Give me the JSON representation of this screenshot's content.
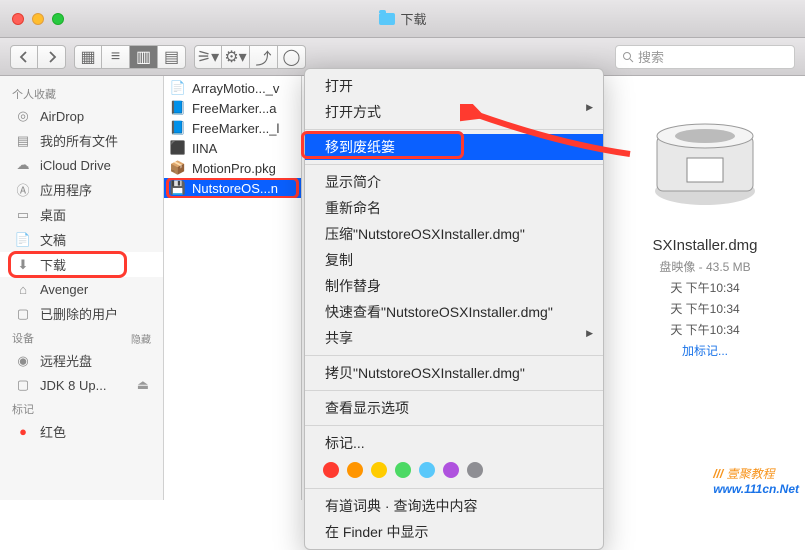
{
  "window": {
    "title": "下载"
  },
  "search": {
    "placeholder": "搜索"
  },
  "sidebar": {
    "favorites_hdr": "个人收藏",
    "items": [
      {
        "label": "AirDrop"
      },
      {
        "label": "我的所有文件"
      },
      {
        "label": "iCloud Drive"
      },
      {
        "label": "应用程序"
      },
      {
        "label": "桌面"
      },
      {
        "label": "文稿"
      },
      {
        "label": "下载"
      },
      {
        "label": "Avenger"
      },
      {
        "label": "已删除的用户"
      }
    ],
    "devices_hdr": "设备",
    "devices": [
      {
        "label": "远程光盘"
      },
      {
        "label": "JDK 8 Up..."
      }
    ],
    "tags_hdr": "标记",
    "tags": [
      {
        "label": "红色"
      }
    ]
  },
  "files": [
    {
      "name": "ArrayMotio..._v"
    },
    {
      "name": "FreeMarker...a"
    },
    {
      "name": "FreeMarker..._l"
    },
    {
      "name": "IINA"
    },
    {
      "name": "MotionPro.pkg"
    },
    {
      "name": "NutstoreOS...n"
    }
  ],
  "ctx": {
    "open": "打开",
    "openwith": "打开方式",
    "trash": "移到废纸篓",
    "getinfo": "显示简介",
    "rename": "重新命名",
    "compress": "压缩\"NutstoreOSXInstaller.dmg\"",
    "dup": "复制",
    "alias": "制作替身",
    "quicklook": "快速查看\"NutstoreOSXInstaller.dmg\"",
    "share": "共享",
    "copy": "拷贝\"NutstoreOSXInstaller.dmg\"",
    "viewopts": "查看显示选项",
    "tags": "标记...",
    "dict": "有道词典 · 查询选中内容",
    "reveal": "在 Finder 中显示"
  },
  "preview": {
    "name": "SXInstaller.dmg",
    "kind": "盘映像 - 43.5 MB",
    "t1": "天 下午10:34",
    "t2": "天 下午10:34",
    "t3": "天 下午10:34",
    "addtag": "加标记..."
  },
  "watermark": {
    "a": "壹聚教程",
    "b": "www.111cn.Net"
  },
  "tagcolors": [
    "#ff3b30",
    "#ff9500",
    "#ffcc00",
    "#4cd964",
    "#5ac8fa",
    "#af52de",
    "#8e8e93"
  ]
}
